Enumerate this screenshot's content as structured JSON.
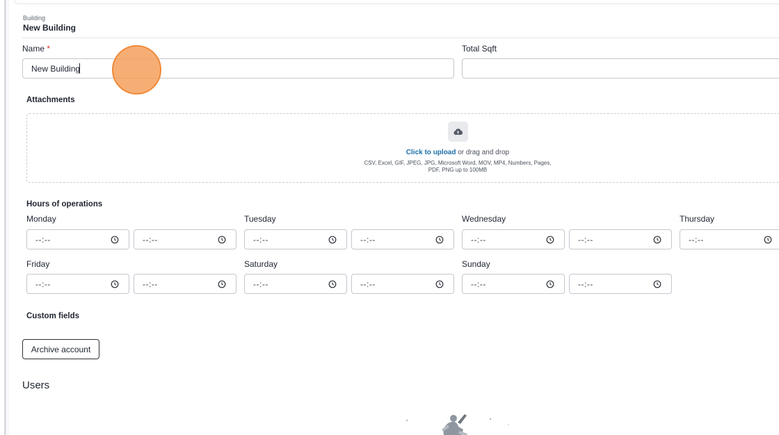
{
  "header": {
    "breadcrumb": "Building",
    "title": "New Building"
  },
  "form": {
    "name_label": "Name",
    "required_mark": "*",
    "name_value": "New Building",
    "total_sqft_label": "Total Sqft",
    "total_sqft_value": ""
  },
  "attachments": {
    "title": "Attachments",
    "click_to_upload": "Click to upload",
    "drag_text": " or drag and drop",
    "types_line1": "CSV, Excel, GIF, JPEG, JPG, Microsoft Word, MOV, MP4, Numbers, Pages,",
    "types_line2": "PDF, PNG up to 100MB",
    "icon": "cloud-upload-icon"
  },
  "hours": {
    "title": "Hours of operations",
    "placeholder": "--:--",
    "days": {
      "monday": "Monday",
      "tuesday": "Tuesday",
      "wednesday": "Wednesday",
      "thursday": "Thursday",
      "friday": "Friday",
      "saturday": "Saturday",
      "sunday": "Sunday"
    },
    "icon": "clock-icon"
  },
  "custom_fields": {
    "title": "Custom fields"
  },
  "actions": {
    "archive_label": "Archive account"
  },
  "users": {
    "heading": "Users"
  },
  "colors": {
    "link": "#1b6fa8",
    "required": "#d93025",
    "click_indicator": "#f6a05c"
  }
}
